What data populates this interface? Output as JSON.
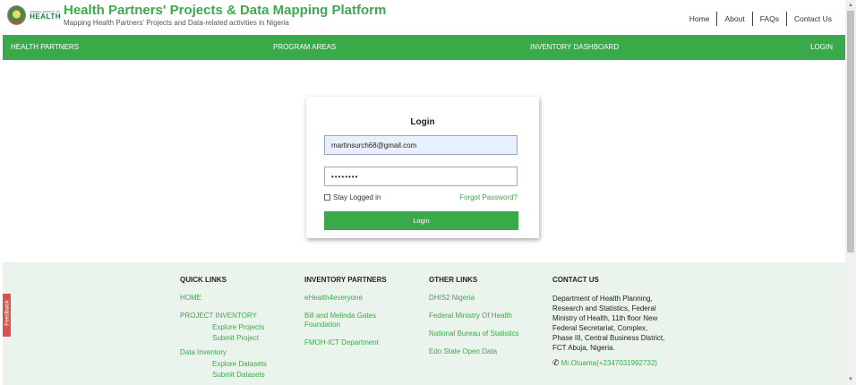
{
  "header": {
    "logo": {
      "small_text": "FEDERAL MINISTRY OF",
      "big_text": "HEALTH"
    },
    "title": "Health Partners' Projects & Data Mapping Platform",
    "subtitle": "Mapping Health Partners' Projects and Data-related activities in Nigeria",
    "top_links": [
      "Home",
      "About",
      "FAQs",
      "Contact Us"
    ]
  },
  "nav": {
    "items": [
      "HEALTH PARTNERS",
      "PROGRAM AREAS",
      "INVENTORY DASHBOARD",
      "LOGIN"
    ]
  },
  "login": {
    "title": "Login",
    "email_value": "martinsurch68@gmail.com",
    "password_value": "••••••••",
    "remember_label": "Stay Logged in",
    "forgot_label": "Forgot Password?",
    "button_label": "Login"
  },
  "footer": {
    "quick_links": {
      "heading": "QUICK LINKS",
      "home": "HOME",
      "project_inventory": "PROJECT INVENTORY",
      "explore_projects": "Explore Projects",
      "submit_project": "Submit Project",
      "data_inventory": "Data Inventory",
      "explore_datasets": "Explore Datasets",
      "submit_datasets": "Submit Datasets"
    },
    "inventory_partners": {
      "heading": "INVENTORY PARTNERS",
      "items": [
        "eHealth4everyone",
        "Bill and Melinda Gates Foundation",
        "FMOH-ICT Department"
      ]
    },
    "other_links": {
      "heading": "OTHER LINKS",
      "items": [
        "DHIS2 Nigeria",
        "Federal Ministry Of Health",
        "National Bureau of Statistics",
        "Edo State Open Data"
      ]
    },
    "contact": {
      "heading": "CONTACT US",
      "address": "Department of Health Planning, Research and Statistics, Federal Ministry of Health, 11th floor New Federal Secretariat, Complex, Phase III, Central Business District, FCT Abuja, Nigeria.",
      "phone": "Mr.Otuama(+2347031992732)"
    }
  },
  "feedback_label": "Feedback",
  "colors": {
    "brand_green": "#3aa94a",
    "footer_bg": "#eaf4ec",
    "feedback_red": "#d9534f"
  },
  "icons": {
    "phone": "phone-icon"
  }
}
